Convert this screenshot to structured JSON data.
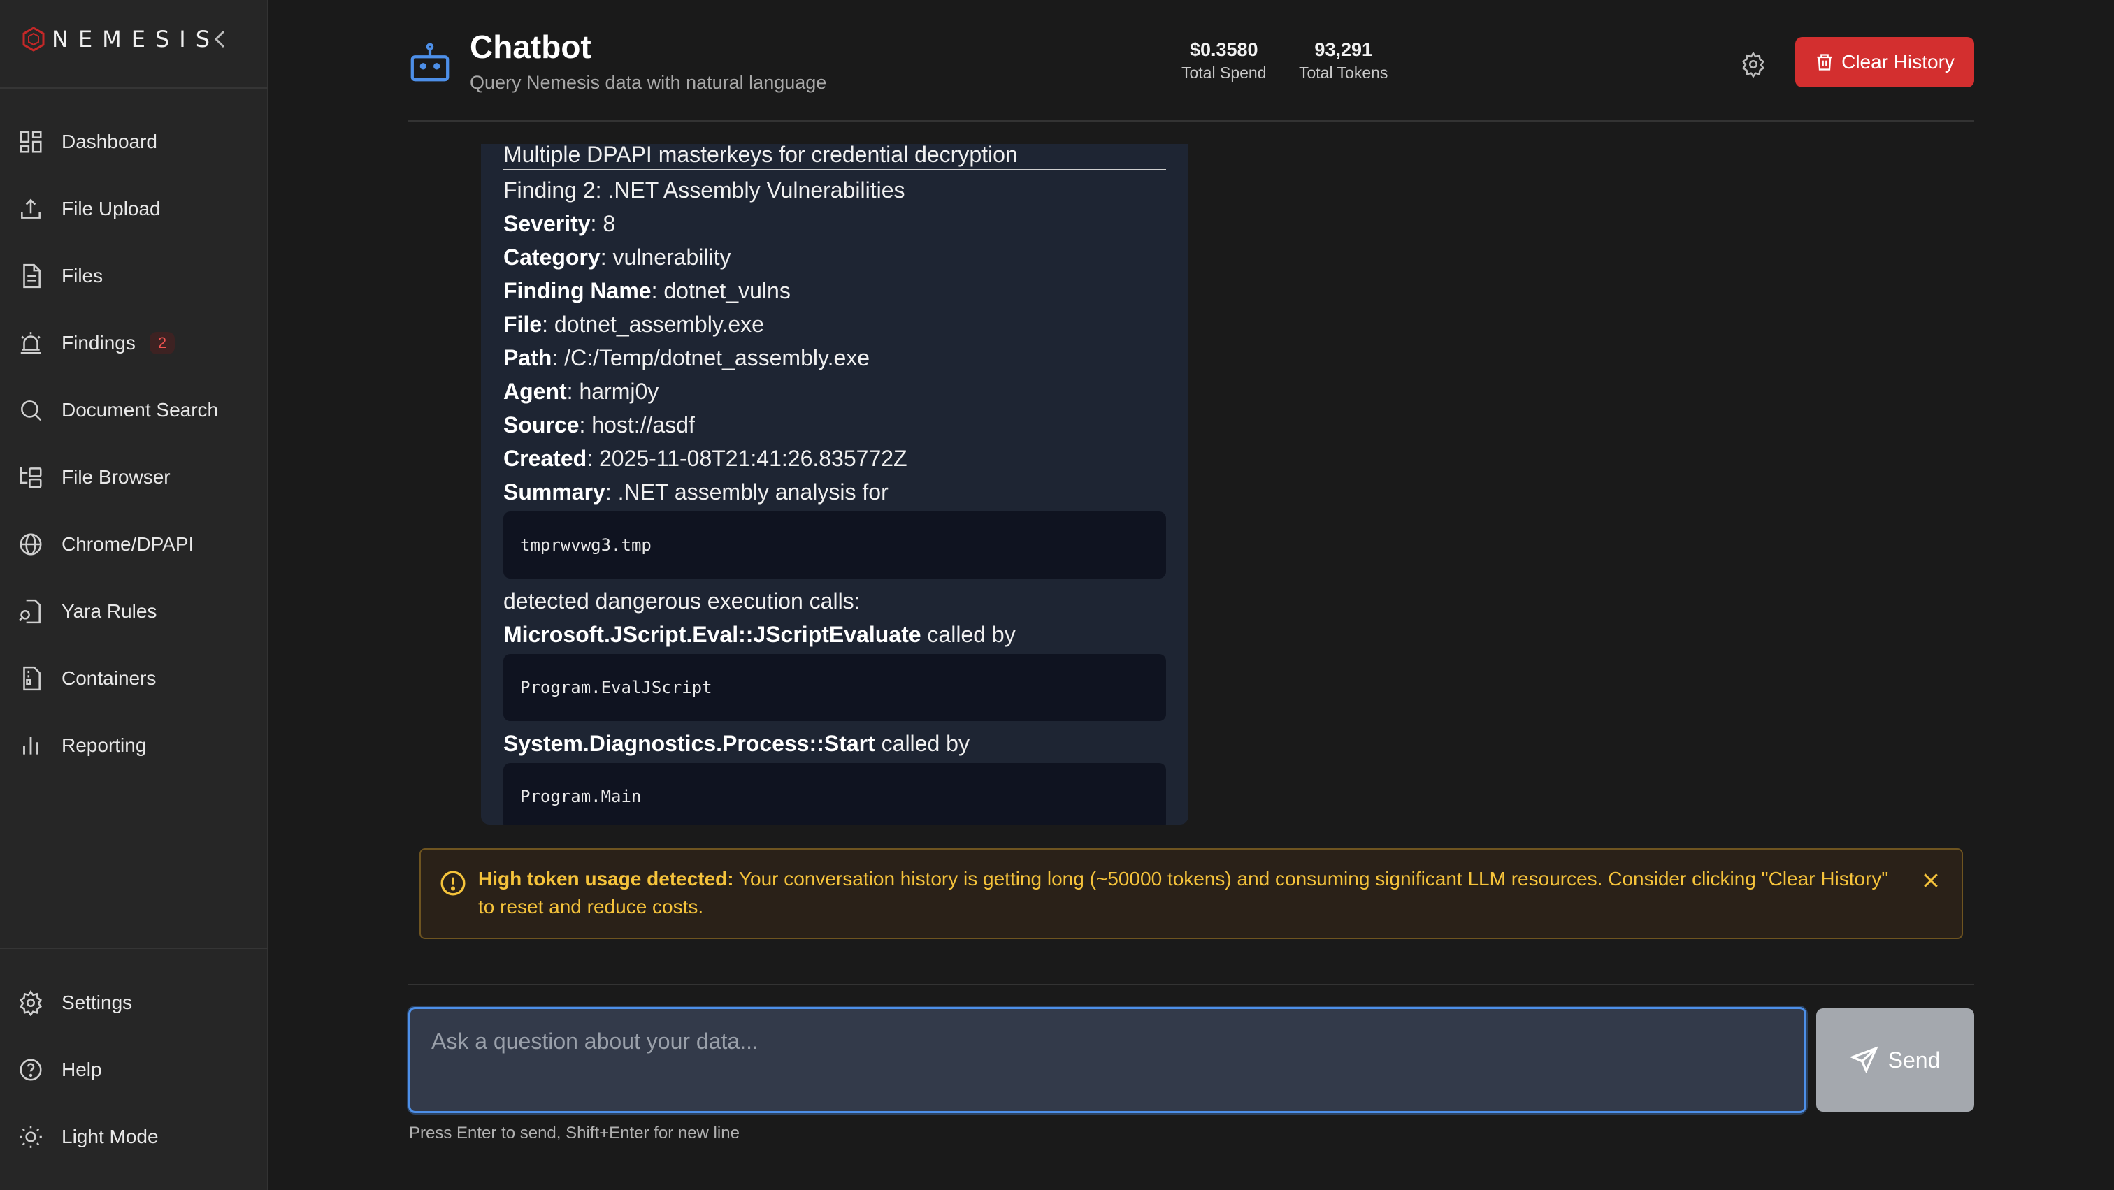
{
  "brand": {
    "name": "NEMESIS",
    "collapse_icon": "chevron-left-icon"
  },
  "sidebar": {
    "items": [
      {
        "label": "Dashboard",
        "icon": "dashboard-icon"
      },
      {
        "label": "File Upload",
        "icon": "upload-icon"
      },
      {
        "label": "Files",
        "icon": "file-icon"
      },
      {
        "label": "Findings",
        "icon": "alarm-icon",
        "badge": "2"
      },
      {
        "label": "Document Search",
        "icon": "search-icon"
      },
      {
        "label": "File Browser",
        "icon": "folder-tree-icon"
      },
      {
        "label": "Chrome/DPAPI",
        "icon": "globe-icon"
      },
      {
        "label": "Yara Rules",
        "icon": "file-search-icon"
      },
      {
        "label": "Containers",
        "icon": "file-archive-icon"
      },
      {
        "label": "Reporting",
        "icon": "bar-chart-icon"
      }
    ],
    "bottom_items": [
      {
        "label": "Settings",
        "icon": "gear-icon"
      },
      {
        "label": "Help",
        "icon": "help-circle-icon"
      },
      {
        "label": "Light Mode",
        "icon": "sun-icon"
      }
    ]
  },
  "header": {
    "title": "Chatbot",
    "subtitle": "Query Nemesis data with natural language",
    "stats": [
      {
        "value": "$0.3580",
        "label": "Total Spend"
      },
      {
        "value": "93,291",
        "label": "Total Tokens"
      }
    ],
    "clear_label": "Clear History"
  },
  "message": {
    "top_line": "Multiple DPAPI masterkeys for credential decryption",
    "finding_title": "Finding 2: .NET Assembly Vulnerabilities",
    "fields": [
      {
        "key": "Severity",
        "value": ": 8"
      },
      {
        "key": "Category",
        "value": ": vulnerability"
      },
      {
        "key": "Finding Name",
        "value": ": dotnet_vulns"
      },
      {
        "key": "File",
        "value": ": dotnet_assembly.exe"
      },
      {
        "key": "Path",
        "value": ": /C:/Temp/dotnet_assembly.exe"
      },
      {
        "key": "Agent",
        "value": ": harmj0y"
      },
      {
        "key": "Source",
        "value": ": host://asdf"
      },
      {
        "key": "Created",
        "value": ": 2025-11-08T21:41:26.835772Z"
      },
      {
        "key": "Summary",
        "value": ": .NET assembly analysis for"
      }
    ],
    "code1": "tmprwvwg3.tmp",
    "detected_text": "detected dangerous execution calls:",
    "call1_name": "Microsoft.JScript.Eval::JScriptEvaluate",
    "call1_suffix": " called by",
    "code2": "Program.EvalJScript",
    "call2_name": "System.Diagnostics.Process::Start",
    "call2_suffix": " called by",
    "code3": "Program.Main"
  },
  "warning": {
    "title": "High token usage detected:",
    "text": " Your conversation history is getting long (~50000 tokens) and consuming significant LLM resources. Consider clicking \"Clear History\" to reset and reduce costs."
  },
  "input": {
    "placeholder": "Ask a question about your data...",
    "value": "",
    "send_label": "Send",
    "hint": "Press Enter to send, Shift+Enter for new line"
  },
  "colors": {
    "accent": "#d32f2f",
    "focus": "#4d8fe8",
    "warning": "#f5c33b",
    "header_icon": "#4d8fe8"
  }
}
